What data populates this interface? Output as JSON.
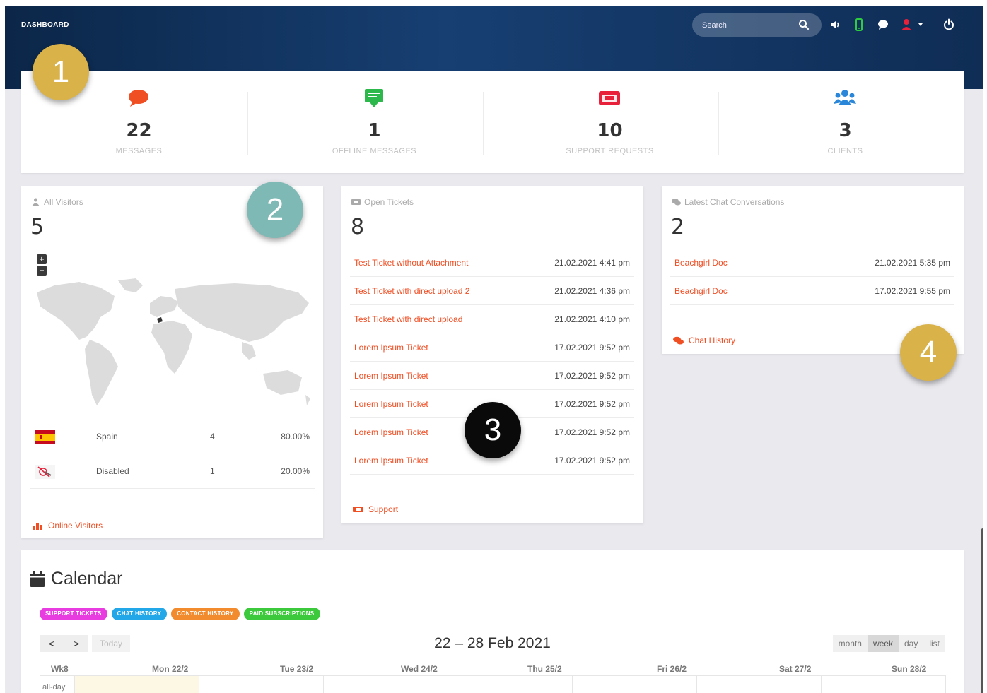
{
  "header": {
    "title": "DASHBOARD",
    "search_placeholder": "Search"
  },
  "stats": [
    {
      "value": "22",
      "label": "MESSAGES",
      "icon": "chat-bubble-icon",
      "color": "#f04e23"
    },
    {
      "value": "1",
      "label": "OFFLINE MESSAGES",
      "icon": "message-icon",
      "color": "#2db84b"
    },
    {
      "value": "10",
      "label": "SUPPORT REQUESTS",
      "icon": "ticket-icon",
      "color": "#e8203a"
    },
    {
      "value": "3",
      "label": "CLIENTS",
      "icon": "users-icon",
      "color": "#2a86d9"
    }
  ],
  "visitors": {
    "title": "All Visitors",
    "count": "5",
    "zoom_in": "+",
    "zoom_out": "−",
    "rows": [
      {
        "name": "Spain",
        "count": "4",
        "percent": "80.00%",
        "flag": "spain-flag-icon"
      },
      {
        "name": "Disabled",
        "count": "1",
        "percent": "20.00%",
        "flag": "disabled-icon"
      }
    ],
    "footer": "Online Visitors"
  },
  "tickets": {
    "title": "Open Tickets",
    "count": "8",
    "rows": [
      {
        "title": "Test Ticket without Attachment",
        "date": "21.02.2021 4:41 pm"
      },
      {
        "title": "Test Ticket with direct upload 2",
        "date": "21.02.2021 4:36 pm"
      },
      {
        "title": "Test Ticket with direct upload",
        "date": "21.02.2021 4:10 pm"
      },
      {
        "title": "Lorem Ipsum Ticket",
        "date": "17.02.2021 9:52 pm"
      },
      {
        "title": "Lorem Ipsum Ticket",
        "date": "17.02.2021 9:52 pm"
      },
      {
        "title": "Lorem Ipsum Ticket",
        "date": "17.02.2021 9:52 pm"
      },
      {
        "title": "Lorem Ipsum Ticket",
        "date": "17.02.2021 9:52 pm"
      },
      {
        "title": "Lorem Ipsum Ticket",
        "date": "17.02.2021 9:52 pm"
      }
    ],
    "footer": "Support"
  },
  "chats": {
    "title": "Latest Chat Conversations",
    "count": "2",
    "rows": [
      {
        "title": "Beachgirl Doc",
        "date": "21.02.2021 5:35 pm"
      },
      {
        "title": "Beachgirl Doc",
        "date": "17.02.2021 9:55 pm"
      }
    ],
    "footer": "Chat History"
  },
  "calendar": {
    "title": "Calendar",
    "tags": [
      {
        "label": "SUPPORT TICKETS",
        "color": "#e83ce0"
      },
      {
        "label": "CHAT HISTORY",
        "color": "#22a7e8"
      },
      {
        "label": "CONTACT HISTORY",
        "color": "#f28a2e"
      },
      {
        "label": "PAID SUBSCRIPTIONS",
        "color": "#3cc93c"
      }
    ],
    "prev": "<",
    "next": ">",
    "today": "Today",
    "range": "22 – 28 Feb 2021",
    "views": [
      "month",
      "week",
      "day",
      "list"
    ],
    "active_view": "week",
    "week_label": "Wk8",
    "days": [
      "Mon 22/2",
      "Tue 23/2",
      "Wed 24/2",
      "Thu 25/2",
      "Fri 26/2",
      "Sat 27/2",
      "Sun 28/2"
    ],
    "allday": "all-day"
  },
  "badges": [
    {
      "label": "1",
      "color": "#d9b24a"
    },
    {
      "label": "2",
      "color": "#7fb9b5"
    },
    {
      "label": "3",
      "color": "#0a0a0a"
    },
    {
      "label": "4",
      "color": "#d9b24a"
    }
  ]
}
